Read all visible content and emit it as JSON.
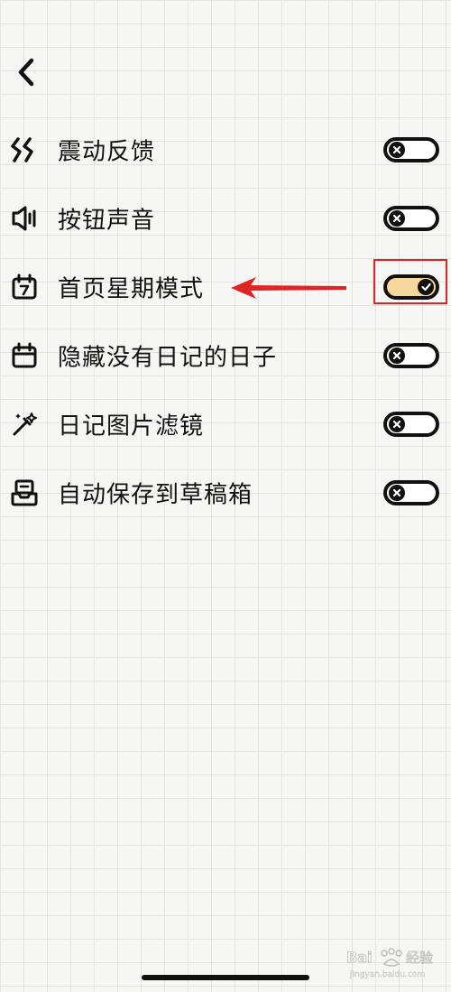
{
  "header": {
    "back_icon": "chevron-left-icon"
  },
  "settings": [
    {
      "label": "震动反馈",
      "icon": "vibration-icon",
      "enabled": false
    },
    {
      "label": "按钮声音",
      "icon": "speaker-icon",
      "enabled": false
    },
    {
      "label": "首页星期模式",
      "icon": "calendar-week-icon",
      "enabled": true
    },
    {
      "label": "隐藏没有日记的日子",
      "icon": "calendar-icon",
      "enabled": false
    },
    {
      "label": "日记图片滤镜",
      "icon": "magic-wand-icon",
      "enabled": false
    },
    {
      "label": "自动保存到草稿箱",
      "icon": "drafts-tray-icon",
      "enabled": false
    }
  ],
  "annotation": {
    "highlight_color": "#e02424",
    "highlighted_setting": "首页星期模式"
  },
  "colors": {
    "toggle_on_fill": "#f6d89c",
    "toggle_border": "#111111",
    "background": "#f6f6f4"
  },
  "watermark": {
    "text": "Bai 经验",
    "subtext": "jingyan.baidu.com"
  }
}
